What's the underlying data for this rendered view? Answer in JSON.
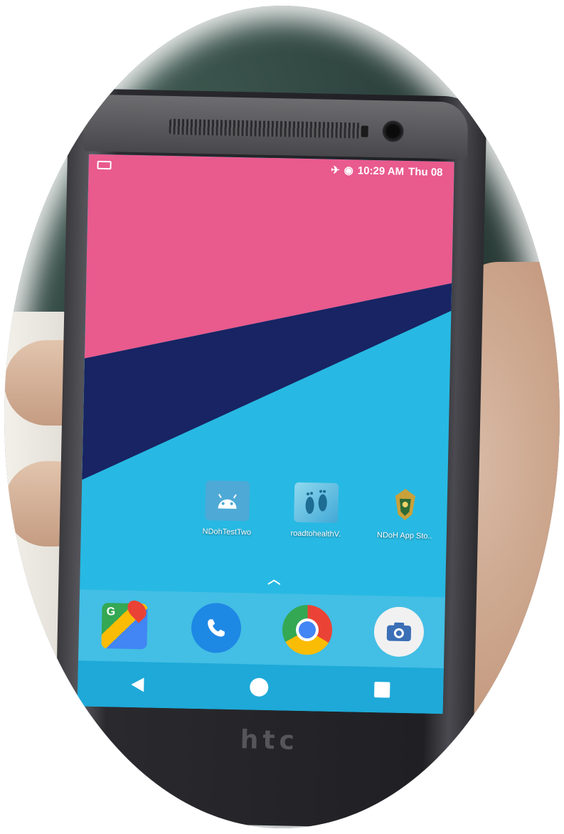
{
  "status_bar": {
    "time": "10:29 AM",
    "day": "Thu 08",
    "icons": [
      "notification-icon",
      "airplane-mode-icon",
      "data-saver-icon"
    ]
  },
  "home_apps": [
    {
      "label": "NDohTestTwo",
      "icon": "android-icon"
    },
    {
      "label": "roadtohealthV.",
      "icon": "footprints-icon"
    },
    {
      "label": "NDoH App Sto..",
      "icon": "coat-of-arms-icon"
    }
  ],
  "dock_apps": [
    {
      "name": "maps-icon"
    },
    {
      "name": "phone-icon"
    },
    {
      "name": "chrome-icon"
    },
    {
      "name": "camera-icon"
    }
  ],
  "device": {
    "brand_logo": "htc"
  },
  "colors": {
    "wallpaper_pink": "#e95a8d",
    "wallpaper_navy": "#182463",
    "wallpaper_blue": "#27b9e3"
  }
}
